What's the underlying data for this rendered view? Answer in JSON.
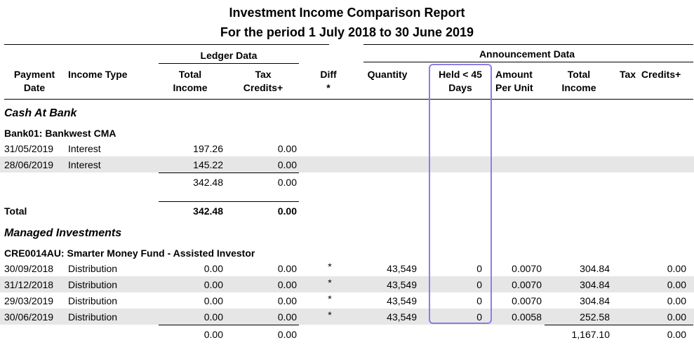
{
  "report": {
    "title": "Investment Income Comparison Report",
    "subtitle": "For the period 1 July 2018 to 30 June 2019"
  },
  "headers": {
    "ledger_group": "Ledger Data",
    "announcement_group": "Announcement Data",
    "payment_date_1": "Payment",
    "payment_date_2": "Date",
    "income_type": "Income Type",
    "total_income_1": "Total",
    "total_income_2": "Income",
    "tax_credits_1": "Tax",
    "tax_credits_2": "Credits+",
    "diff_1": "Diff",
    "diff_2": "*",
    "quantity": "Quantity",
    "held_1": "Held < 45",
    "held_2": "Days",
    "amount_1": "Amount",
    "amount_2": "Per Unit",
    "ann_total_1": "Total",
    "ann_total_2": "Income",
    "ann_tax": "Tax  Credits+"
  },
  "cash": {
    "section": "Cash At Bank",
    "account": "Bank01: Bankwest CMA",
    "rows": [
      {
        "date": "31/05/2019",
        "type": "Interest",
        "total": "197.26",
        "tax": "0.00"
      },
      {
        "date": "28/06/2019",
        "type": "Interest",
        "total": "145.22",
        "tax": "0.00"
      }
    ],
    "subtotal": {
      "total": "342.48",
      "tax": "0.00"
    },
    "total_label": "Total",
    "total": {
      "total": "342.48",
      "tax": "0.00"
    }
  },
  "managed": {
    "section": "Managed Investments",
    "account": "CRE0014AU: Smarter Money Fund - Assisted Investor",
    "rows": [
      {
        "date": "30/09/2018",
        "type": "Distribution",
        "total": "0.00",
        "tax": "0.00",
        "diff": "*",
        "qty": "43,549",
        "held": "0",
        "amount": "0.0070",
        "ann_total": "304.84",
        "ann_tax": "0.00"
      },
      {
        "date": "31/12/2018",
        "type": "Distribution",
        "total": "0.00",
        "tax": "0.00",
        "diff": "*",
        "qty": "43,549",
        "held": "0",
        "amount": "0.0070",
        "ann_total": "304.84",
        "ann_tax": "0.00"
      },
      {
        "date": "29/03/2019",
        "type": "Distribution",
        "total": "0.00",
        "tax": "0.00",
        "diff": "*",
        "qty": "43,549",
        "held": "0",
        "amount": "0.0070",
        "ann_total": "304.84",
        "ann_tax": "0.00"
      },
      {
        "date": "30/06/2019",
        "type": "Distribution",
        "total": "0.00",
        "tax": "0.00",
        "diff": "*",
        "qty": "43,549",
        "held": "0",
        "amount": "0.0058",
        "ann_total": "252.58",
        "ann_tax": "0.00"
      }
    ],
    "subtotal": {
      "total": "0.00",
      "tax": "0.00",
      "ann_total": "1,167.10",
      "ann_tax": "0.00"
    }
  }
}
